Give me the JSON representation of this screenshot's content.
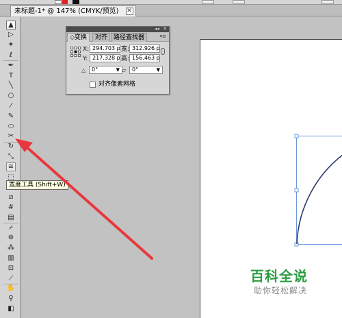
{
  "document_tab": {
    "title": "未标题-1* @ 147% (CMYK/预览)",
    "close": "✕"
  },
  "transform_panel": {
    "tabs": [
      "变换",
      "对齐",
      "路径查找器"
    ],
    "tab_marker": "◇",
    "collapse": "◂◂",
    "close": "✕",
    "menu": "▾≡",
    "x_label": "X:",
    "x_value": "294.703 px",
    "y_label": "Y:",
    "y_value": "217.328 px",
    "w_label": "宽:",
    "w_value": "312.926 px",
    "h_label": "高:",
    "h_value": "156.463 px",
    "rotate_icon": "△",
    "rotate_value": "0°",
    "shear_icon": "▱",
    "shear_value": "0°",
    "pixel_grid_label": "对齐像素网格",
    "pixel_grid_checked": false
  },
  "tooltip": {
    "text": "宽度工具 (Shift+W)"
  },
  "toolbar": {
    "tools": [
      {
        "name": "selection-tool",
        "glyph": "▲"
      },
      {
        "name": "direct-selection-tool",
        "glyph": "▷"
      },
      {
        "name": "magic-wand-tool",
        "glyph": "✶"
      },
      {
        "name": "lasso-tool",
        "glyph": "ℓ"
      },
      {
        "name": "pen-tool",
        "glyph": "✒"
      },
      {
        "name": "type-tool",
        "glyph": "T"
      },
      {
        "name": "line-segment-tool",
        "glyph": "╲"
      },
      {
        "name": "ellipse-tool",
        "glyph": "○"
      },
      {
        "name": "paintbrush-tool",
        "glyph": "⁄"
      },
      {
        "name": "pencil-tool",
        "glyph": "✎"
      },
      {
        "name": "blob-brush-tool",
        "glyph": "⬭"
      },
      {
        "name": "scissors-tool",
        "glyph": "✂"
      },
      {
        "name": "rotate-tool",
        "glyph": "↻"
      },
      {
        "name": "scale-tool",
        "glyph": "⤡"
      },
      {
        "name": "width-tool",
        "glyph": "≋"
      },
      {
        "name": "free-transform-tool",
        "glyph": "⬚"
      },
      {
        "name": "shape-builder-tool",
        "glyph": "◔"
      },
      {
        "name": "perspective-grid-tool",
        "glyph": "⧄"
      },
      {
        "name": "mesh-tool",
        "glyph": "#"
      },
      {
        "name": "gradient-tool",
        "glyph": "▤"
      },
      {
        "name": "eyedropper-tool",
        "glyph": "⌿"
      },
      {
        "name": "blend-tool",
        "glyph": "⊚"
      },
      {
        "name": "symbol-sprayer-tool",
        "glyph": "⁂"
      },
      {
        "name": "column-graph-tool",
        "glyph": "▥"
      },
      {
        "name": "artboard-tool",
        "glyph": "⊡"
      },
      {
        "name": "slice-tool",
        "glyph": "⟋"
      },
      {
        "name": "hand-tool",
        "glyph": "✋"
      },
      {
        "name": "zoom-tool",
        "glyph": "⚲"
      },
      {
        "name": "fill-stroke-swatch",
        "glyph": "◧"
      }
    ]
  },
  "watermark": {
    "title": "百科全说",
    "subtitle": "助你轻松解决"
  },
  "colors": {
    "annotation_arrow": "#e8383d",
    "watermark_green": "#2a9d3f",
    "selection_blue": "#4a7fd4"
  }
}
